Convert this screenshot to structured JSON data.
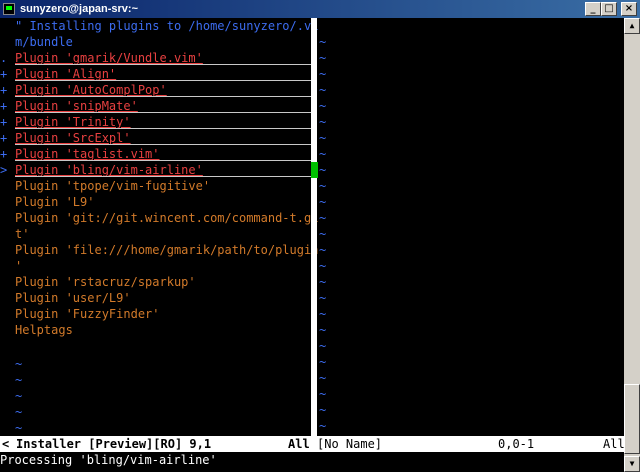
{
  "window": {
    "title": "sunyzero@japan-srv:~"
  },
  "buffer": {
    "header_line1": "\" Installing plugins to /home/sunyzero/.vi",
    "header_line2": "m/bundle",
    "lines": [
      {
        "sign": ".",
        "text": "Plugin 'gmarik/Vundle.vim'",
        "state": "done"
      },
      {
        "sign": "+",
        "text": "Plugin 'Align'",
        "state": "done"
      },
      {
        "sign": "+",
        "text": "Plugin 'AutoComplPop'",
        "state": "done"
      },
      {
        "sign": "+",
        "text": "Plugin 'snipMate'",
        "state": "done"
      },
      {
        "sign": "+",
        "text": "Plugin 'Trinity'",
        "state": "done"
      },
      {
        "sign": "+",
        "text": "Plugin 'SrcExpl'",
        "state": "done"
      },
      {
        "sign": "+",
        "text": "Plugin 'taglist.vim'",
        "state": "done"
      },
      {
        "sign": ">",
        "text": "Plugin 'bling/vim-airline'",
        "state": "active"
      },
      {
        "sign": "",
        "text": "Plugin 'tpope/vim-fugitive'",
        "state": "pending"
      },
      {
        "sign": "",
        "text": "Plugin 'L9'",
        "state": "pending"
      },
      {
        "sign": "",
        "text": "Plugin 'git://git.wincent.com/command-t.gi",
        "state": "pending"
      },
      {
        "sign": "",
        "text": "t'",
        "state": "pending"
      },
      {
        "sign": "",
        "text": "Plugin 'file:///home/gmarik/path/to/plugin",
        "state": "pending"
      },
      {
        "sign": "",
        "text": "'",
        "state": "pending"
      },
      {
        "sign": "",
        "text": "Plugin 'rstacruz/sparkup'",
        "state": "pending"
      },
      {
        "sign": "",
        "text": "Plugin 'user/L9'",
        "state": "pending"
      },
      {
        "sign": "",
        "text": "Plugin 'FuzzyFinder'",
        "state": "pending"
      },
      {
        "sign": "",
        "text": "Helptags",
        "state": "pending"
      }
    ],
    "tilde": "~"
  },
  "statusline": {
    "left_marker": "<",
    "left_name": "Installer [Preview][RO] 9,1",
    "left_pct": "All",
    "right_name": "[No Name]",
    "right_pos": "0,0-1",
    "right_pct": "All"
  },
  "cmdline": "Processing 'bling/vim-airline'",
  "colors": {
    "comment": "#3c6cf0",
    "plugin_text": "#d27a2a",
    "installed": "#e84040",
    "cursor": "#00c000"
  }
}
